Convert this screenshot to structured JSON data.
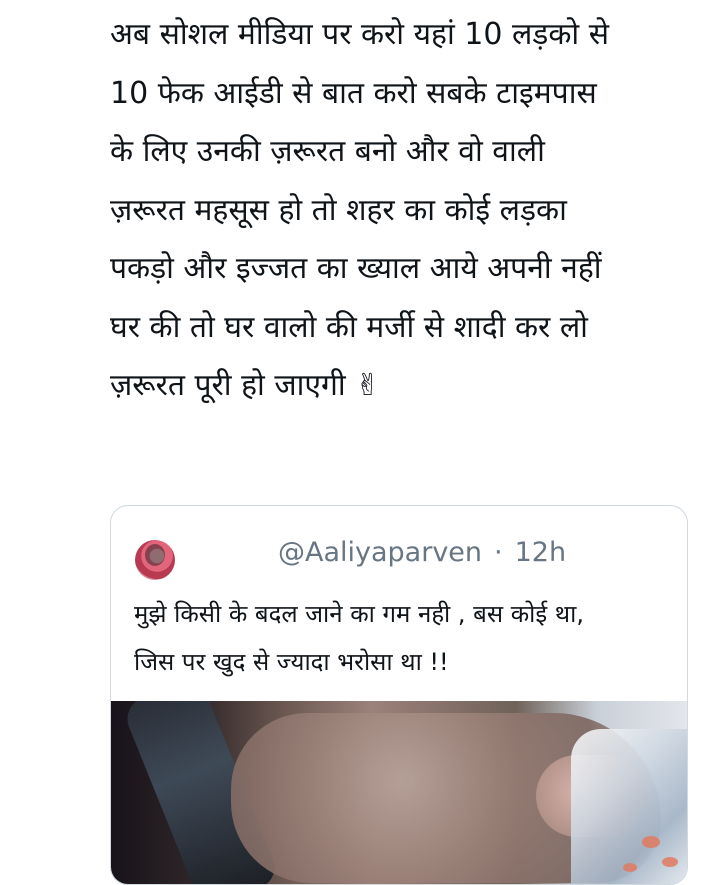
{
  "tweet": {
    "lines": [
      "अब सोशल मीडिया पर करो यहां 10 लड़को से",
      "10 फेक आईडी से बात करो सबके टाइमपास",
      "के लिए उनकी ज़रूरत बनो और वो वाली",
      "ज़रूरत महसूस हो तो शहर का कोई लड़का",
      "पकड़ो और इज्जत का ख्याल आये अपनी नहीं",
      "घर की तो घर वालो की मर्जी से शादी कर लो",
      "ज़रूरत पूरी हो जाएगी ✌"
    ]
  },
  "quote": {
    "handle": "@Aaliyaparven",
    "separator": "·",
    "time": "12h",
    "text_lines": [
      "मुझे किसी के बदल जाने का गम नही , बस कोई था,",
      "जिस पर खुद से ज्यादा भरोसा था !!"
    ],
    "avatar_icon": "profile-avatar",
    "media_icon": "photo-media"
  }
}
